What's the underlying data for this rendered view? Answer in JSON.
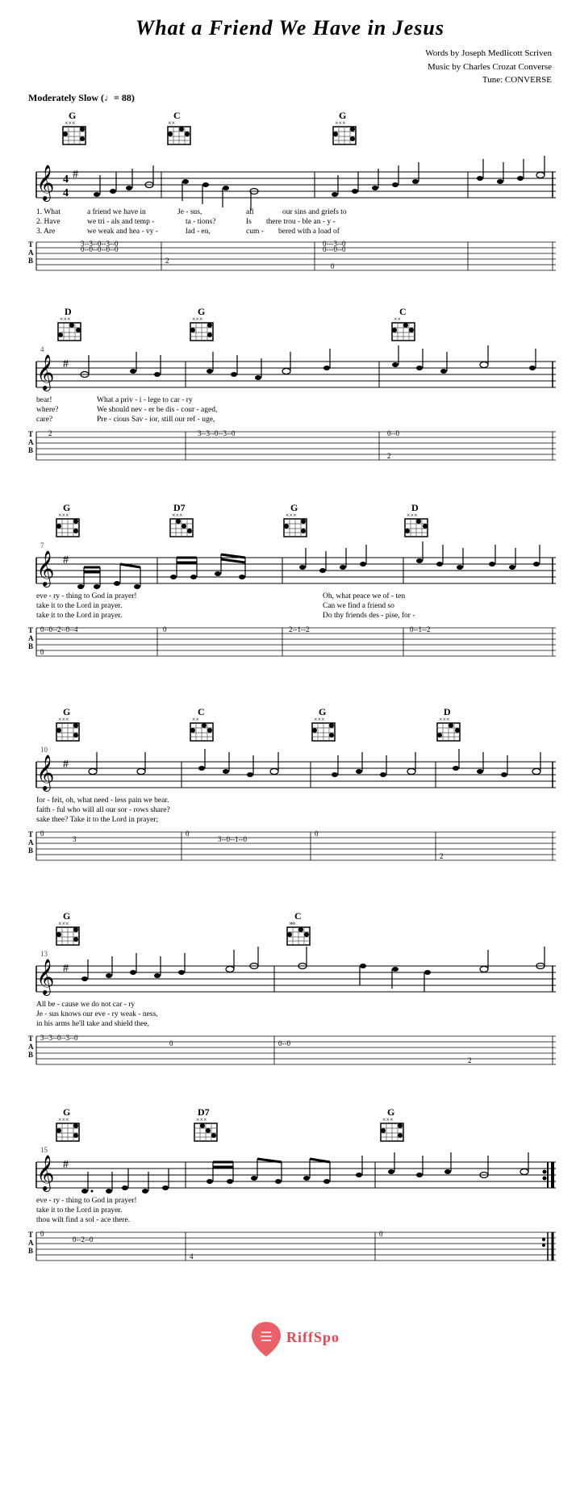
{
  "title": "What a Friend We Have in Jesus",
  "attribution": {
    "line1": "Words by Joseph Medlicott Scriven",
    "line2": "Music by Charles Crozat Converse",
    "line3": "Tune: CONVERSE"
  },
  "tempo": {
    "text": "Moderately Slow (",
    "bpm": "= 88",
    "full": "Moderately Slow (♩= 88)"
  },
  "systems": [
    {
      "id": "system1",
      "measureStart": 1,
      "chords": [
        "G",
        "C",
        "G"
      ],
      "lyrics": [
        "1. What   a  friend  we  have  in    Je  -  sus,      all    our  sins  and  griefs  to",
        "2. Have   we  tri  - als  and  temp  - ta  -  tions?   Is   there  trou - ble   an  - y  -",
        "3. Are    we  weak  and  hea  - vy  -  lad  -  en,     cum  -  bered  with  a   load  of"
      ],
      "tab": {
        "e": "3--3--0--3--0--------------------------0---3--0",
        "B": "0--0--0--0--0--------------------------0---0--0",
        "G": "",
        "D": "2",
        "A": "",
        "E": "0"
      }
    },
    {
      "id": "system2",
      "measureStart": 4,
      "chords": [
        "D",
        "G",
        "C"
      ],
      "lyrics": [
        "bear!        What    a   priv - i - lege  to    car  -  ry",
        "where?       We   should  nev - er   be   dis - cour  -  aged,",
        "care?        Pre  - cious  Sav - ior,  still   our   ref  -  uge,"
      ],
      "tab": {
        "e": "3--3--0--3--0---0--0",
        "B": "2",
        "G": "",
        "D": "",
        "A": "",
        "E": "2"
      }
    },
    {
      "id": "system3",
      "measureStart": 7,
      "chords": [
        "G",
        "D7",
        "G",
        "D"
      ],
      "lyrics": [
        "eve - ry - thing  to  God   in  prayer!    Oh,    what  peace  we  of - ten",
        "take   it   to   the  Lord  in  prayer.   Can    we   find   a   friend  so",
        "take   it   to   the  Lord  in  prayer.   Do    thy  friends  des - pise,  for -"
      ],
      "tab": {
        "e": "0--0--2--0--4---0---2--1--2--0--1--2",
        "B": "",
        "G": "",
        "D": "",
        "A": "",
        "E": "0"
      }
    },
    {
      "id": "system4",
      "measureStart": 10,
      "chords": [
        "G",
        "C",
        "G",
        "D"
      ],
      "lyrics": [
        "for  -  feit,    oh,    what  need - less  pain  we   bear.",
        "faith  -  ful     who   will   all   our  sor - rows  share?",
        "sake     thee?   Take    it    to   the   Lord   in   prayer;"
      ],
      "tab": {
        "e": "0--3--0--3--0--1--0",
        "B": "0",
        "G": "",
        "D": "3",
        "A": "",
        "E": "0--2"
      }
    },
    {
      "id": "system5",
      "measureStart": 13,
      "chords": [
        "G",
        "C"
      ],
      "lyrics": [
        "All    be - cause  we   do   not   car  -  ry",
        "Je  -  sus  knows  our  eve - ry   weak - ness,",
        "in    his   arms  he'll  take  and  shield  thee,"
      ],
      "tab": {
        "e": "3--3--0--3--0---0--0",
        "B": "",
        "G": "",
        "D": "",
        "A": "0",
        "E": "3--2"
      }
    },
    {
      "id": "system6",
      "measureStart": 15,
      "chords": [
        "G",
        "D7",
        "G"
      ],
      "lyrics": [
        "eve  -  ry - thing  to   God   in   prayer!",
        "take    it   to   the  Lord   in   prayer.",
        "thou   wilt  find   a   sol - ace   there."
      ],
      "tab": {
        "e": "0--0--2--0--4---0",
        "B": "",
        "G": "",
        "D": "",
        "A": "",
        "E": "0"
      }
    }
  ],
  "logo": {
    "icon": "♩",
    "name": "RiffSpot"
  }
}
